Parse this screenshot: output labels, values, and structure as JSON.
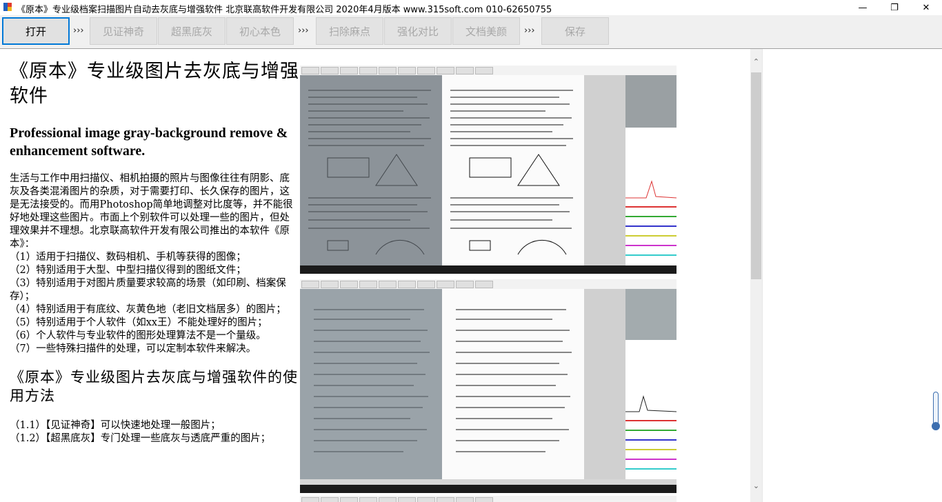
{
  "window": {
    "title": "《原本》专业级档案扫描图片自动去灰底与增强软件 北京联高软件开发有限公司 2020年4月版本 www.315soft.com 010-62650755",
    "minimize": "—",
    "maximize": "❐",
    "close": "✕"
  },
  "toolbar": {
    "open": "打开",
    "arrow": "›››",
    "buttons": [
      "见证神奇",
      "超黑底灰",
      "初心本色",
      "扫除麻点",
      "强化对比",
      "文档美颜",
      "保存"
    ]
  },
  "doc": {
    "title": "《原本》专业级图片去灰底与增强软件",
    "subtitle_en": "Professional image gray-background remove & enhancement software.",
    "paragraphs": [
      "生活与工作中用扫描仪、相机拍摄的照片与图像往往有阴影、底灰及各类混淆图片的杂质，对于需要打印、长久保存的图片，这是无法接受的。而用Photoshop简单地调整对比度等，并不能很好地处理这些图片。市面上个别软件可以处理一些的图片，但处理效果并不理想。北京联高软件开发有限公司推出的本软件《原本》：",
      "（1）适用于扫描仪、数码相机、手机等获得的图像；",
      "（2）特别适用于大型、中型扫描仪得到的图纸文件；",
      "（3）特别适用于对图片质量要求较高的场景（如印刷、档案保存）；",
      "（4）特别适用于有底纹、灰黄色地（老旧文档居多）的图片；",
      "（5）特别适用于个人软件（如xx王）不能处理好的图片；",
      "（6）个人软件与专业软件的图形处理算法不是一个量级。",
      "（7）一些特殊扫描件的处理，可以定制本软件来解决。"
    ],
    "usage_title": "《原本》专业级图片去灰底与增强软件的使用方法",
    "usage": [
      "（1.1）【见证神奇】可以快速地处理一般图片；",
      "（1.2）【超黑底灰】专门处理一些底灰与透底严重的图片；"
    ]
  },
  "scrollbar": {
    "up": "⌃",
    "down": "⌄"
  },
  "colors": {
    "accent": "#0078d7",
    "disabled_text": "#a8a8a8",
    "toolbar_bg": "#f0f0f0"
  }
}
